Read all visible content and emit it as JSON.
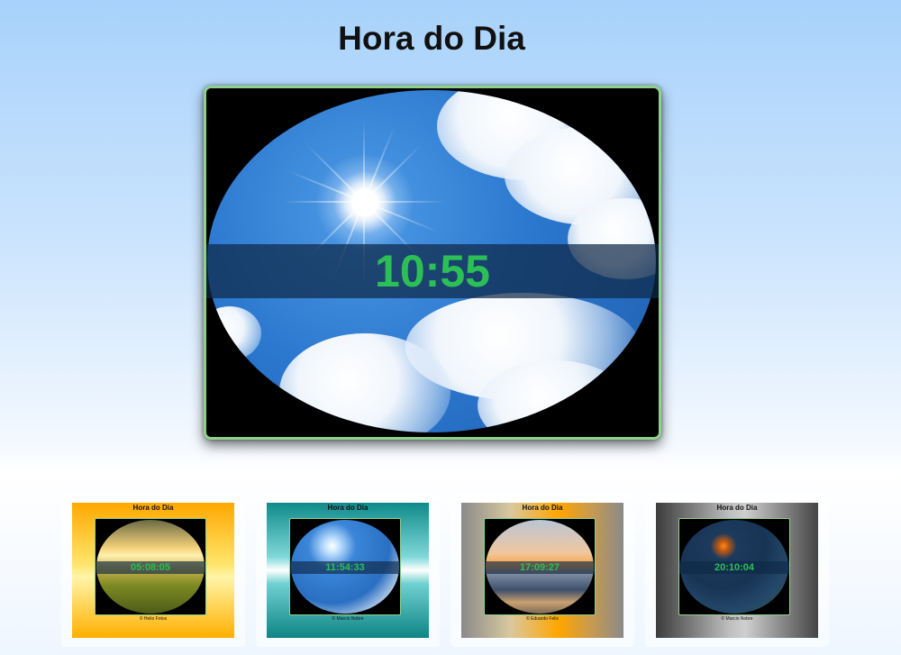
{
  "page": {
    "title": "Hora do Dia"
  },
  "main_clock": {
    "time": "10:55",
    "scene": "sunny-sky"
  },
  "colors": {
    "time_text": "#2bc056",
    "frame_border": "#8fd18b",
    "background_top": "#a8d2fb"
  },
  "thumbnails": [
    {
      "title": "Hora do Dia",
      "time": "05:08:05",
      "caption": "© Helio Fotos",
      "scene": "sunrise-field",
      "bg": "linear-gradient(to bottom, #ffa800 0%, #ffe46a 45%, #fff4a8 55%, #ffb000 100%)"
    },
    {
      "title": "Hora do Dia",
      "time": "11:54:33",
      "caption": "© Marcio Nobre",
      "scene": "sunny-sky",
      "bg": "linear-gradient(to bottom, #0f8a8a 0%, #7fd8d8 40%, #ffffff 50%, #6fd0d0 60%, #0e8585 100%)"
    },
    {
      "title": "Hora do Dia",
      "time": "17:09:27",
      "caption": "© Eduardo Felix",
      "scene": "sunset-lake",
      "bg": "linear-gradient(to right, #8a8a8a 0%, #d8c8a0 30%, #ffa600 60%, #c89a50 80%, #8a8a8a 100%)"
    },
    {
      "title": "Hora do Dia",
      "time": "20:10:04",
      "caption": "© Marcio Nobre",
      "scene": "night-forest",
      "bg": "linear-gradient(to right, #3c3c3c 0%, #bdbdbd 45%, #cfcfcf 55%, #444 100%)"
    }
  ]
}
